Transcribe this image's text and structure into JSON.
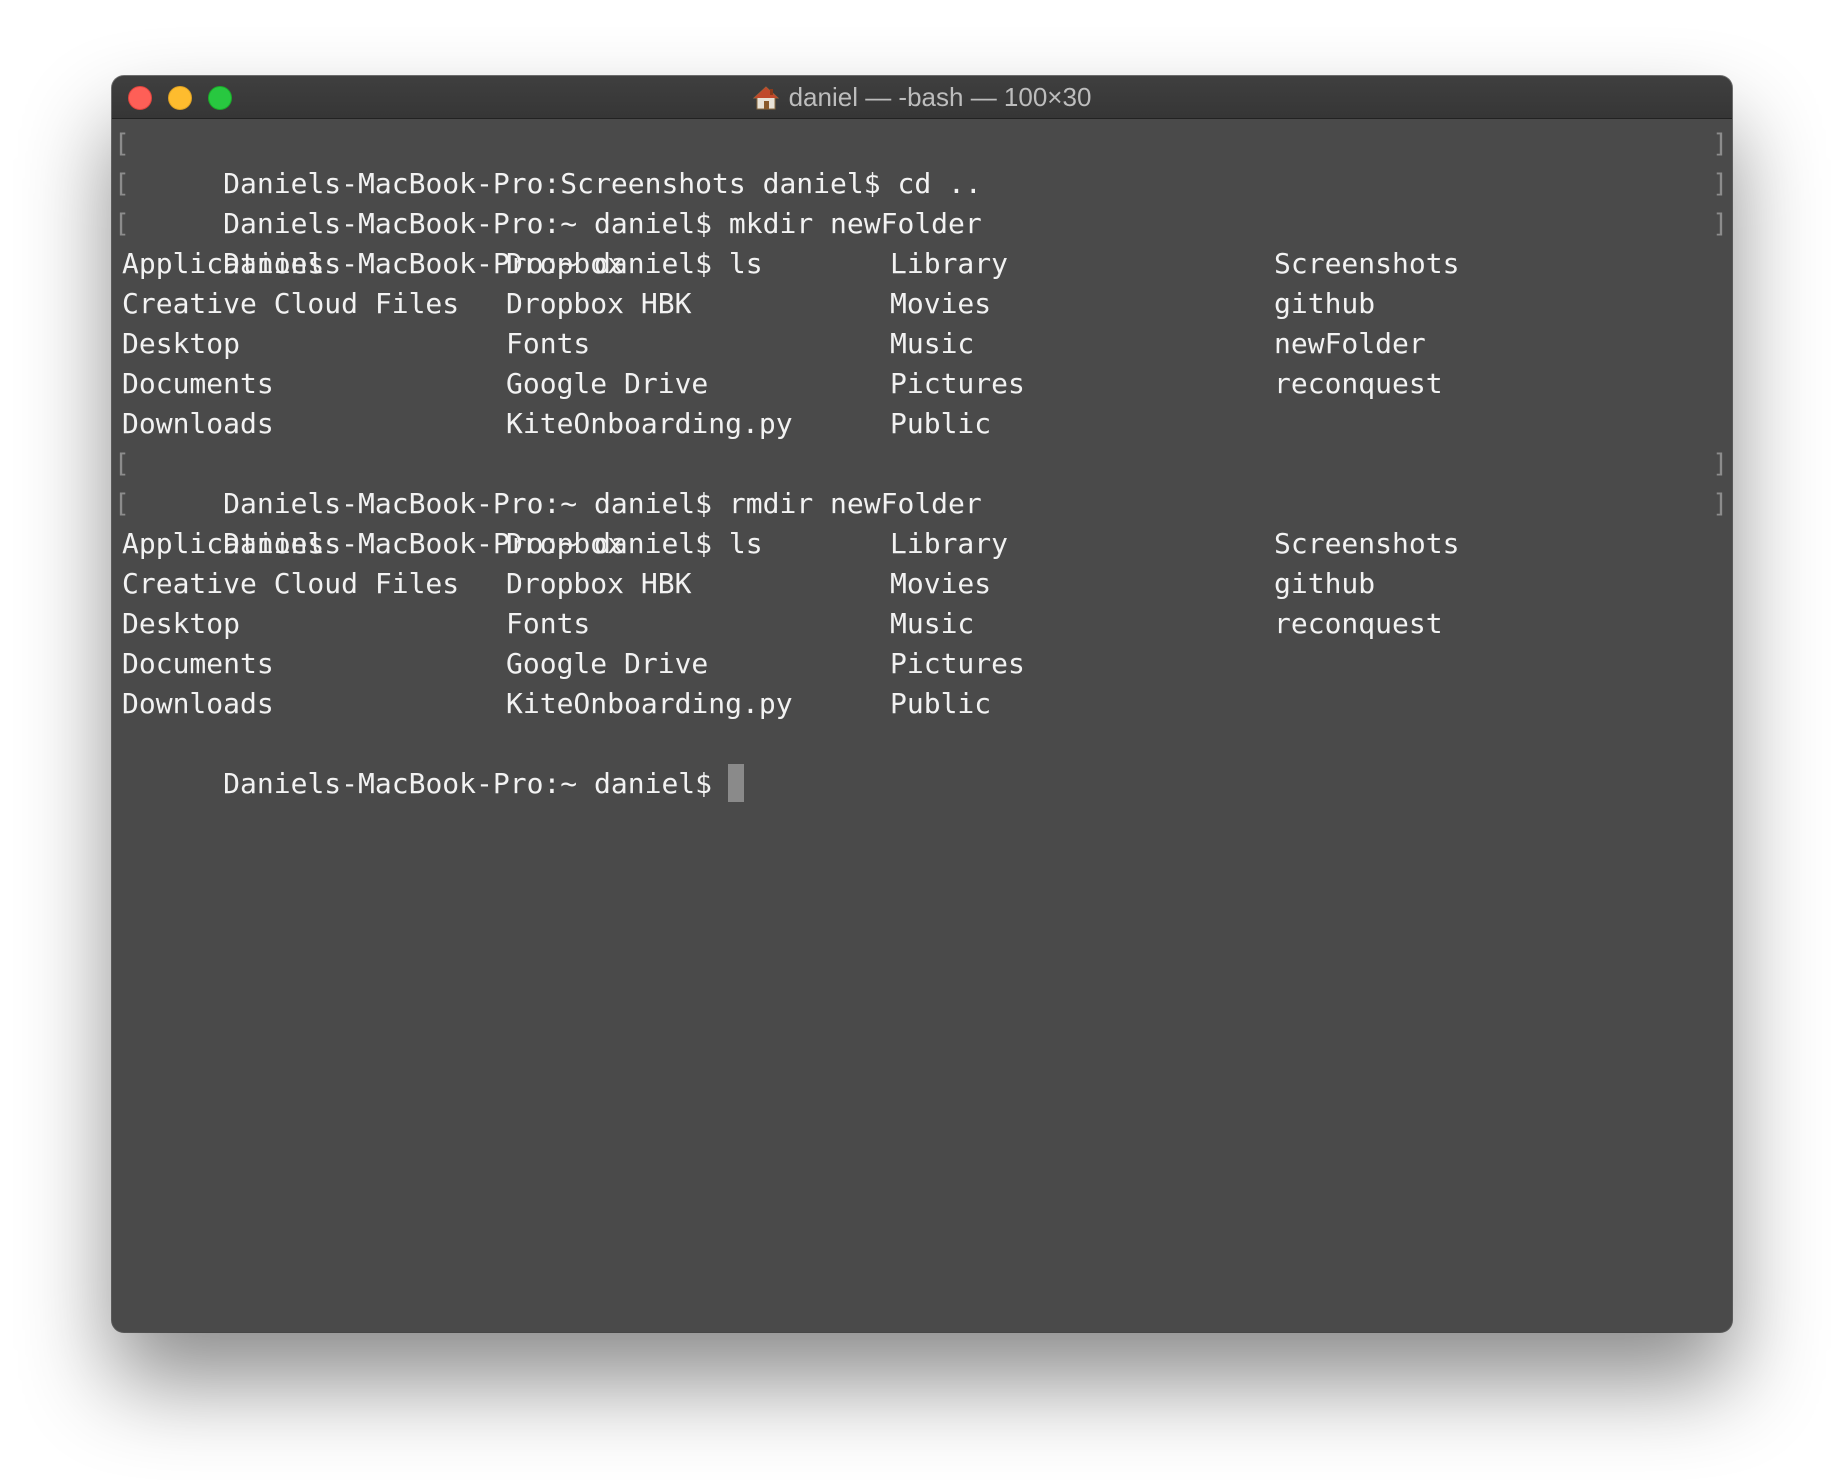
{
  "window": {
    "title": "daniel — -bash — 100×30",
    "title_icon": "home-icon"
  },
  "terminal": {
    "commands": [
      {
        "prompt": "Daniels-MacBook-Pro:Screenshots daniel$",
        "command": "cd .."
      },
      {
        "prompt": "Daniels-MacBook-Pro:~ daniel$",
        "command": "mkdir newFolder"
      },
      {
        "prompt": "Daniels-MacBook-Pro:~ daniel$",
        "command": "ls"
      },
      {
        "prompt": "Daniels-MacBook-Pro:~ daniel$",
        "command": "rmdir newFolder"
      },
      {
        "prompt": "Daniels-MacBook-Pro:~ daniel$",
        "command": "ls"
      }
    ],
    "ls_output_1": [
      [
        "Applications",
        "Dropbox",
        "Library",
        "Screenshots"
      ],
      [
        "Creative Cloud Files",
        "Dropbox HBK",
        "Movies",
        "github"
      ],
      [
        "Desktop",
        "Fonts",
        "Music",
        "newFolder"
      ],
      [
        "Documents",
        "Google Drive",
        "Pictures",
        "reconquest"
      ],
      [
        "Downloads",
        "KiteOnboarding.py",
        "Public",
        ""
      ]
    ],
    "ls_output_2": [
      [
        "Applications",
        "Dropbox",
        "Library",
        "Screenshots"
      ],
      [
        "Creative Cloud Files",
        "Dropbox HBK",
        "Movies",
        "github"
      ],
      [
        "Desktop",
        "Fonts",
        "Music",
        "reconquest"
      ],
      [
        "Documents",
        "Google Drive",
        "Pictures",
        ""
      ],
      [
        "Downloads",
        "KiteOnboarding.py",
        "Public",
        ""
      ]
    ],
    "current_prompt": "Daniels-MacBook-Pro:~ daniel$",
    "mark_left": "[",
    "mark_right": "]"
  }
}
